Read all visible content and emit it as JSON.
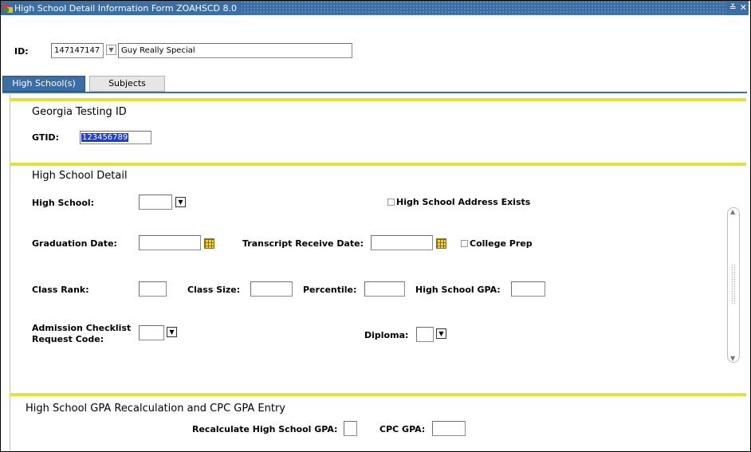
{
  "window": {
    "title": "High School Detail Information Form  ZOAHSCD  8.0",
    "minimize_glyph": "≚",
    "close_glyph": "✕"
  },
  "key_block": {
    "id_label": "ID:",
    "id_value": "147147147",
    "name_value": "Guy Really Special"
  },
  "tabs": [
    {
      "label": "High School(s)",
      "active": true
    },
    {
      "label": "Subjects",
      "active": false
    }
  ],
  "georgia": {
    "section_title": "Georgia Testing ID",
    "gtid_label": "GTID:",
    "gtid_value": "123456789"
  },
  "detail": {
    "section_title": "High School Detail",
    "high_school_label": "High School:",
    "high_school_value": "",
    "address_exists_label": "High School Address Exists",
    "graduation_date_label": "Graduation Date:",
    "graduation_date_value": "",
    "transcript_date_label": "Transcript Receive Date:",
    "transcript_date_value": "",
    "college_prep_label": "College Prep",
    "class_rank_label": "Class Rank:",
    "class_size_label": "Class Size:",
    "percentile_label": "Percentile:",
    "gpa_label": "High School GPA:",
    "admission_label_line1": "Admission Checklist",
    "admission_label_line2": "Request Code:",
    "diploma_label": "Diploma:"
  },
  "recalc": {
    "section_title": "High School GPA Recalculation and CPC GPA Entry",
    "recalc_label": "Recalculate High School GPA:",
    "cpc_label": "CPC GPA:"
  },
  "colors": {
    "titlebar": "#3a6ea5",
    "section_rule": "#e2e23a",
    "selection": "#1a3fd8"
  }
}
